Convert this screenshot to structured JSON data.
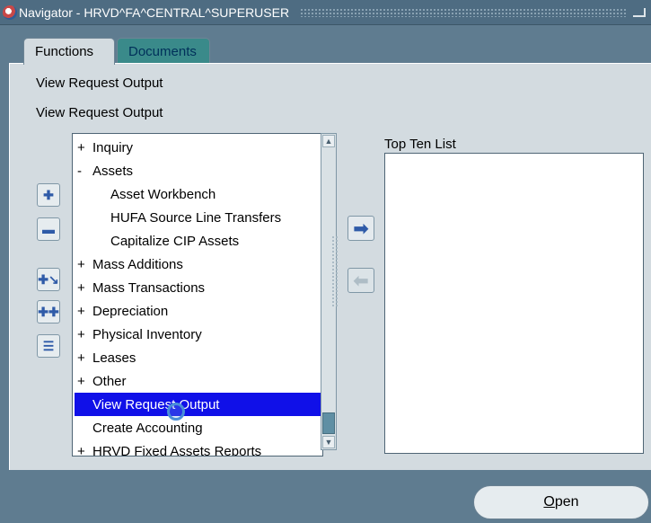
{
  "window": {
    "title": "Navigator - HRVD^FA^CENTRAL^SUPERUSER"
  },
  "tabs": [
    {
      "label": "Functions",
      "active": true
    },
    {
      "label": "Documents",
      "active": false
    }
  ],
  "headings": [
    "View Request Output",
    "View Request Output"
  ],
  "tree": {
    "items": [
      {
        "expander": "+",
        "label": "Inquiry",
        "level": 0
      },
      {
        "expander": "-",
        "label": "Assets",
        "level": 0
      },
      {
        "expander": "",
        "label": "Asset Workbench",
        "level": 1
      },
      {
        "expander": "",
        "label": "HUFA Source Line Transfers",
        "level": 1
      },
      {
        "expander": "",
        "label": "Capitalize CIP Assets",
        "level": 1
      },
      {
        "expander": "+",
        "label": "Mass Additions",
        "level": 0
      },
      {
        "expander": "+",
        "label": "Mass Transactions",
        "level": 0
      },
      {
        "expander": "+",
        "label": "Depreciation",
        "level": 0
      },
      {
        "expander": "+",
        "label": "Physical Inventory",
        "level": 0
      },
      {
        "expander": "+",
        "label": "Leases",
        "level": 0
      },
      {
        "expander": "+",
        "label": "Other",
        "level": 0
      },
      {
        "expander": "",
        "label": "View Request Output",
        "level": 0,
        "selected": true
      },
      {
        "expander": "",
        "label": "Create Accounting",
        "level": 0
      },
      {
        "expander": "+",
        "label": "HRVD Fixed Assets Reports",
        "level": 0
      }
    ]
  },
  "top_ten": {
    "label": "Top Ten List"
  },
  "buttons": {
    "open_label_prefix": "O",
    "open_label_rest": "pen"
  },
  "icons": {
    "expand": "expand-icon",
    "collapse": "collapse-icon",
    "expand_all": "expand-all-icon",
    "expand_branch": "expand-branch-icon",
    "collapse_all": "collapse-all-icon",
    "add_to_list": "right-arrow-icon",
    "remove_from_list": "left-arrow-icon"
  },
  "colors": {
    "selection": "#1010e8",
    "background": "#5f7c90",
    "panel": "#d3dbe0",
    "tab_documents": "#3a8a8a"
  }
}
